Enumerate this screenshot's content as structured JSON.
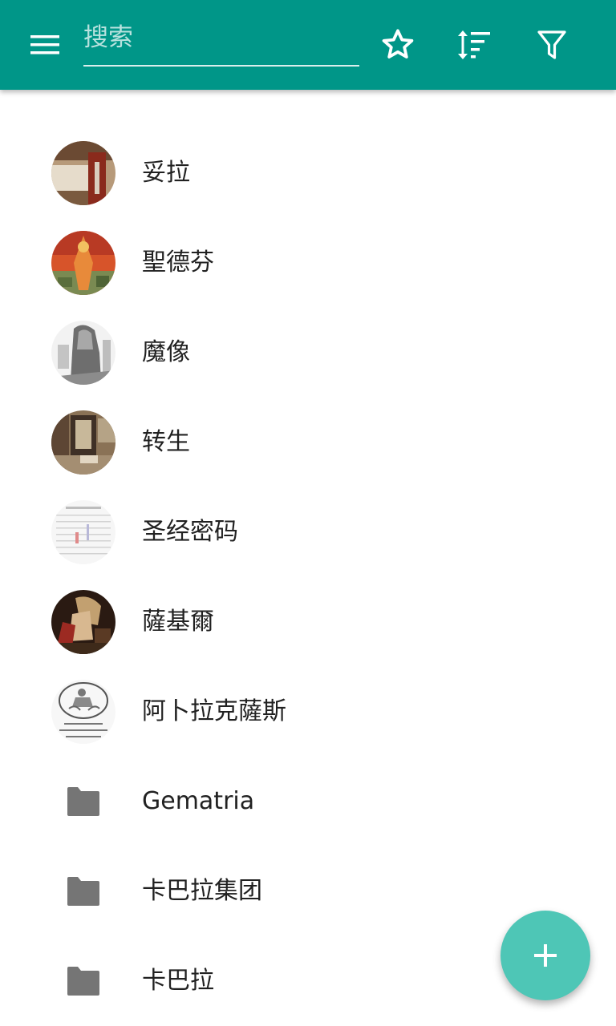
{
  "toolbar": {
    "search": {
      "placeholder": "搜索",
      "value": ""
    },
    "accent_color": "#009688",
    "icons": [
      "menu-icon",
      "star-outline-icon",
      "sort-icon",
      "filter-icon"
    ]
  },
  "items": [
    {
      "label": "妥拉",
      "kind": "entry",
      "thumbnail": "sepia-photo"
    },
    {
      "label": "聖德芬",
      "kind": "entry",
      "thumbnail": "orange-painting"
    },
    {
      "label": "魔像",
      "kind": "entry",
      "thumbnail": "engraving"
    },
    {
      "label": "转生",
      "kind": "entry",
      "thumbnail": "interior-photo"
    },
    {
      "label": "圣经密码",
      "kind": "entry",
      "thumbnail": "letter-grid"
    },
    {
      "label": "薩基爾",
      "kind": "entry",
      "thumbnail": "dark-painting"
    },
    {
      "label": "阿卜拉克薩斯",
      "kind": "entry",
      "thumbnail": "amulet-drawing"
    },
    {
      "label": "Gematria",
      "kind": "folder",
      "icon": "folder-icon"
    },
    {
      "label": "卡巴拉集团",
      "kind": "folder",
      "icon": "folder-icon"
    },
    {
      "label": "卡巴拉",
      "kind": "folder",
      "icon": "folder-icon"
    }
  ],
  "fab": {
    "icon": "plus-icon",
    "color": "#4ec6b6"
  }
}
